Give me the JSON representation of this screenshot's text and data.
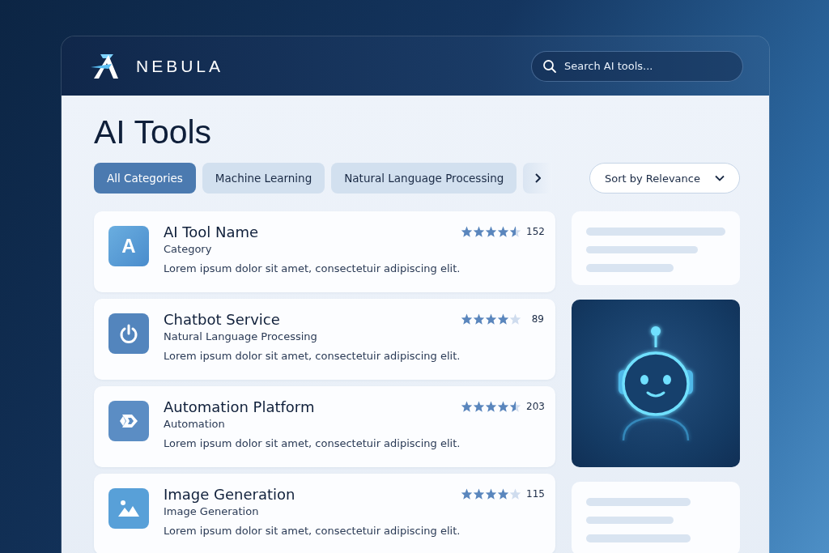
{
  "brand": {
    "name": "NEBULA"
  },
  "search": {
    "placeholder": "Search AI tools..."
  },
  "page_title": "AI Tools",
  "filters": [
    {
      "label": "All Categories",
      "selected": true
    },
    {
      "label": "Machine Learning",
      "selected": false
    },
    {
      "label": "Natural Language Processing",
      "selected": false
    }
  ],
  "sort": {
    "value": "Sort by Relevance"
  },
  "tools": [
    {
      "name": "AI Tool Name",
      "category": "Category",
      "description": "Lorem ipsum dolor sit amet, consectetuir adipiscing elit.",
      "stars": 4.5,
      "count": "152",
      "kind": "letter",
      "letter": "A"
    },
    {
      "name": "Chatbot Service",
      "category": "Natural Language Processing",
      "description": "Lorem ipsum dolor sit amet, consectetuir adipiscing elit.",
      "stars": 4,
      "count": "89",
      "kind": "power"
    },
    {
      "name": "Automation Platform",
      "category": "Automation",
      "description": "Lorem ipsum dolor sit amet, consectetuir adipiscing elit.",
      "stars": 4.5,
      "count": "203",
      "kind": "automation"
    },
    {
      "name": "Image Generation",
      "category": "Image Generation",
      "description": "Lorem ipsum dolor sit amet, consectetuir adipiscing elit.",
      "stars": 4,
      "count": "115",
      "kind": "image"
    }
  ]
}
